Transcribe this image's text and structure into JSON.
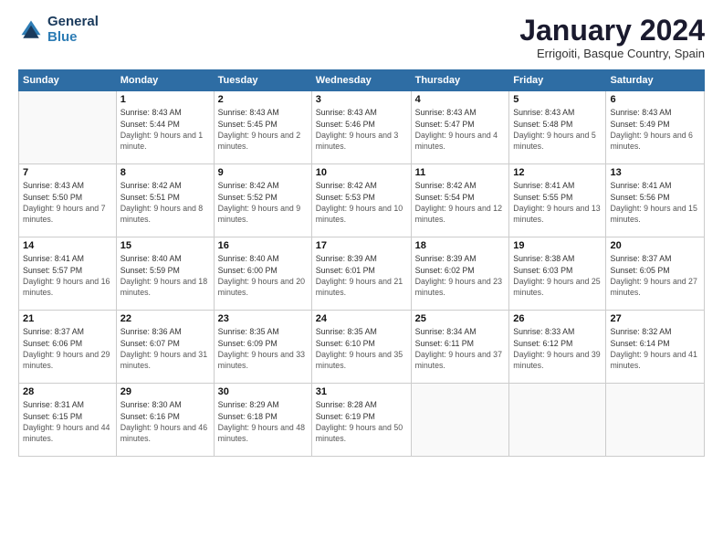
{
  "logo": {
    "line1": "General",
    "line2": "Blue"
  },
  "header": {
    "month_year": "January 2024",
    "location": "Errigoiti, Basque Country, Spain"
  },
  "weekdays": [
    "Sunday",
    "Monday",
    "Tuesday",
    "Wednesday",
    "Thursday",
    "Friday",
    "Saturday"
  ],
  "weeks": [
    [
      {
        "day": "",
        "sunrise": "",
        "sunset": "",
        "daylight": ""
      },
      {
        "day": "1",
        "sunrise": "Sunrise: 8:43 AM",
        "sunset": "Sunset: 5:44 PM",
        "daylight": "Daylight: 9 hours and 1 minute."
      },
      {
        "day": "2",
        "sunrise": "Sunrise: 8:43 AM",
        "sunset": "Sunset: 5:45 PM",
        "daylight": "Daylight: 9 hours and 2 minutes."
      },
      {
        "day": "3",
        "sunrise": "Sunrise: 8:43 AM",
        "sunset": "Sunset: 5:46 PM",
        "daylight": "Daylight: 9 hours and 3 minutes."
      },
      {
        "day": "4",
        "sunrise": "Sunrise: 8:43 AM",
        "sunset": "Sunset: 5:47 PM",
        "daylight": "Daylight: 9 hours and 4 minutes."
      },
      {
        "day": "5",
        "sunrise": "Sunrise: 8:43 AM",
        "sunset": "Sunset: 5:48 PM",
        "daylight": "Daylight: 9 hours and 5 minutes."
      },
      {
        "day": "6",
        "sunrise": "Sunrise: 8:43 AM",
        "sunset": "Sunset: 5:49 PM",
        "daylight": "Daylight: 9 hours and 6 minutes."
      }
    ],
    [
      {
        "day": "7",
        "sunrise": "Sunrise: 8:43 AM",
        "sunset": "Sunset: 5:50 PM",
        "daylight": "Daylight: 9 hours and 7 minutes."
      },
      {
        "day": "8",
        "sunrise": "Sunrise: 8:42 AM",
        "sunset": "Sunset: 5:51 PM",
        "daylight": "Daylight: 9 hours and 8 minutes."
      },
      {
        "day": "9",
        "sunrise": "Sunrise: 8:42 AM",
        "sunset": "Sunset: 5:52 PM",
        "daylight": "Daylight: 9 hours and 9 minutes."
      },
      {
        "day": "10",
        "sunrise": "Sunrise: 8:42 AM",
        "sunset": "Sunset: 5:53 PM",
        "daylight": "Daylight: 9 hours and 10 minutes."
      },
      {
        "day": "11",
        "sunrise": "Sunrise: 8:42 AM",
        "sunset": "Sunset: 5:54 PM",
        "daylight": "Daylight: 9 hours and 12 minutes."
      },
      {
        "day": "12",
        "sunrise": "Sunrise: 8:41 AM",
        "sunset": "Sunset: 5:55 PM",
        "daylight": "Daylight: 9 hours and 13 minutes."
      },
      {
        "day": "13",
        "sunrise": "Sunrise: 8:41 AM",
        "sunset": "Sunset: 5:56 PM",
        "daylight": "Daylight: 9 hours and 15 minutes."
      }
    ],
    [
      {
        "day": "14",
        "sunrise": "Sunrise: 8:41 AM",
        "sunset": "Sunset: 5:57 PM",
        "daylight": "Daylight: 9 hours and 16 minutes."
      },
      {
        "day": "15",
        "sunrise": "Sunrise: 8:40 AM",
        "sunset": "Sunset: 5:59 PM",
        "daylight": "Daylight: 9 hours and 18 minutes."
      },
      {
        "day": "16",
        "sunrise": "Sunrise: 8:40 AM",
        "sunset": "Sunset: 6:00 PM",
        "daylight": "Daylight: 9 hours and 20 minutes."
      },
      {
        "day": "17",
        "sunrise": "Sunrise: 8:39 AM",
        "sunset": "Sunset: 6:01 PM",
        "daylight": "Daylight: 9 hours and 21 minutes."
      },
      {
        "day": "18",
        "sunrise": "Sunrise: 8:39 AM",
        "sunset": "Sunset: 6:02 PM",
        "daylight": "Daylight: 9 hours and 23 minutes."
      },
      {
        "day": "19",
        "sunrise": "Sunrise: 8:38 AM",
        "sunset": "Sunset: 6:03 PM",
        "daylight": "Daylight: 9 hours and 25 minutes."
      },
      {
        "day": "20",
        "sunrise": "Sunrise: 8:37 AM",
        "sunset": "Sunset: 6:05 PM",
        "daylight": "Daylight: 9 hours and 27 minutes."
      }
    ],
    [
      {
        "day": "21",
        "sunrise": "Sunrise: 8:37 AM",
        "sunset": "Sunset: 6:06 PM",
        "daylight": "Daylight: 9 hours and 29 minutes."
      },
      {
        "day": "22",
        "sunrise": "Sunrise: 8:36 AM",
        "sunset": "Sunset: 6:07 PM",
        "daylight": "Daylight: 9 hours and 31 minutes."
      },
      {
        "day": "23",
        "sunrise": "Sunrise: 8:35 AM",
        "sunset": "Sunset: 6:09 PM",
        "daylight": "Daylight: 9 hours and 33 minutes."
      },
      {
        "day": "24",
        "sunrise": "Sunrise: 8:35 AM",
        "sunset": "Sunset: 6:10 PM",
        "daylight": "Daylight: 9 hours and 35 minutes."
      },
      {
        "day": "25",
        "sunrise": "Sunrise: 8:34 AM",
        "sunset": "Sunset: 6:11 PM",
        "daylight": "Daylight: 9 hours and 37 minutes."
      },
      {
        "day": "26",
        "sunrise": "Sunrise: 8:33 AM",
        "sunset": "Sunset: 6:12 PM",
        "daylight": "Daylight: 9 hours and 39 minutes."
      },
      {
        "day": "27",
        "sunrise": "Sunrise: 8:32 AM",
        "sunset": "Sunset: 6:14 PM",
        "daylight": "Daylight: 9 hours and 41 minutes."
      }
    ],
    [
      {
        "day": "28",
        "sunrise": "Sunrise: 8:31 AM",
        "sunset": "Sunset: 6:15 PM",
        "daylight": "Daylight: 9 hours and 44 minutes."
      },
      {
        "day": "29",
        "sunrise": "Sunrise: 8:30 AM",
        "sunset": "Sunset: 6:16 PM",
        "daylight": "Daylight: 9 hours and 46 minutes."
      },
      {
        "day": "30",
        "sunrise": "Sunrise: 8:29 AM",
        "sunset": "Sunset: 6:18 PM",
        "daylight": "Daylight: 9 hours and 48 minutes."
      },
      {
        "day": "31",
        "sunrise": "Sunrise: 8:28 AM",
        "sunset": "Sunset: 6:19 PM",
        "daylight": "Daylight: 9 hours and 50 minutes."
      },
      {
        "day": "",
        "sunrise": "",
        "sunset": "",
        "daylight": ""
      },
      {
        "day": "",
        "sunrise": "",
        "sunset": "",
        "daylight": ""
      },
      {
        "day": "",
        "sunrise": "",
        "sunset": "",
        "daylight": ""
      }
    ]
  ]
}
